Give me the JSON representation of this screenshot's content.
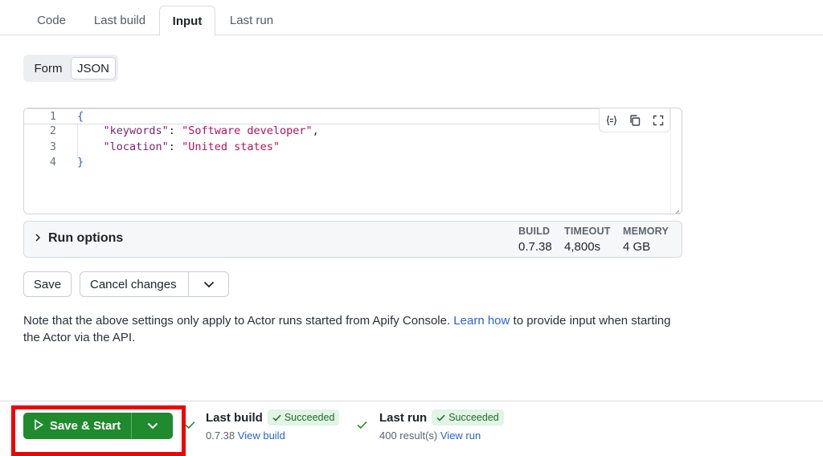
{
  "tabs": [
    {
      "label": "Code",
      "active": false
    },
    {
      "label": "Last build",
      "active": false
    },
    {
      "label": "Input",
      "active": true
    },
    {
      "label": "Last run",
      "active": false
    }
  ],
  "input_mode": {
    "options": [
      "Form",
      "JSON"
    ],
    "selected": "JSON"
  },
  "editor": {
    "line_numbers": [
      "1",
      "2",
      "3",
      "4"
    ],
    "lines": [
      {
        "open": "{"
      },
      {
        "key": "\"keywords\"",
        "colon": ": ",
        "value": "\"Software developer\"",
        "comma": ","
      },
      {
        "key": "\"location\"",
        "colon": ": ",
        "value": "\"United states\"",
        "comma": ""
      },
      {
        "close": "}"
      }
    ],
    "tools": [
      "format-icon",
      "copy-icon",
      "fullscreen-icon"
    ]
  },
  "run_options": {
    "label": "Run options",
    "build_label": "BUILD",
    "build_value": "0.7.38",
    "timeout_label": "TIMEOUT",
    "timeout_value": "4,800s",
    "memory_label": "MEMORY",
    "memory_value": "4 GB"
  },
  "actions": {
    "save_label": "Save",
    "cancel_label": "Cancel changes"
  },
  "note": {
    "before": "Note that the above settings only apply to Actor runs started from Apify Console. ",
    "link": "Learn how",
    "after": " to provide input when starting the Actor via the API."
  },
  "footer": {
    "start_label": "Save & Start",
    "last_build": {
      "title": "Last build",
      "status": "Succeeded",
      "version": "0.7.38",
      "link": "View build"
    },
    "last_run": {
      "title": "Last run",
      "status": "Succeeded",
      "results": "400 result(s)",
      "link": "View run"
    }
  },
  "colors": {
    "primary_green": "#1f8a2e",
    "success_badge_bg": "#e2f4e4",
    "link_blue": "#2a63c9",
    "highlight_red": "#f00000"
  }
}
